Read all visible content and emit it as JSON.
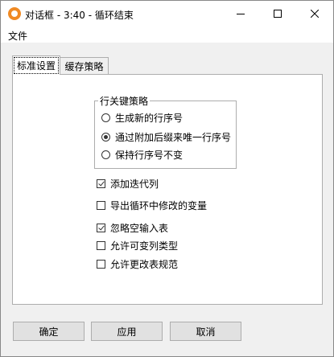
{
  "window": {
    "title": "对话框 - 3:40 - 循环结束",
    "icon": "app-icon"
  },
  "menu": {
    "items": [
      {
        "label": "文件"
      }
    ]
  },
  "tabs": [
    {
      "label": "标准设置",
      "active": true
    },
    {
      "label": "缓存策略",
      "active": false
    }
  ],
  "row_key_strategy": {
    "title": "行关键策略",
    "options": [
      {
        "label": "生成新的行序号",
        "selected": false
      },
      {
        "label": "通过附加后缀来唯一行序号",
        "selected": true
      },
      {
        "label": "保持行序号不变",
        "selected": false
      }
    ]
  },
  "checkboxes": [
    {
      "label": "添加迭代列",
      "checked": true
    },
    {
      "label": "导出循环中修改的变量",
      "checked": false
    },
    {
      "label": "忽略空输入表",
      "checked": true
    },
    {
      "label": "允许可变列类型",
      "checked": false
    },
    {
      "label": "允许更改表规范",
      "checked": false
    }
  ],
  "buttons": {
    "ok": "确定",
    "apply": "应用",
    "cancel": "取消"
  }
}
